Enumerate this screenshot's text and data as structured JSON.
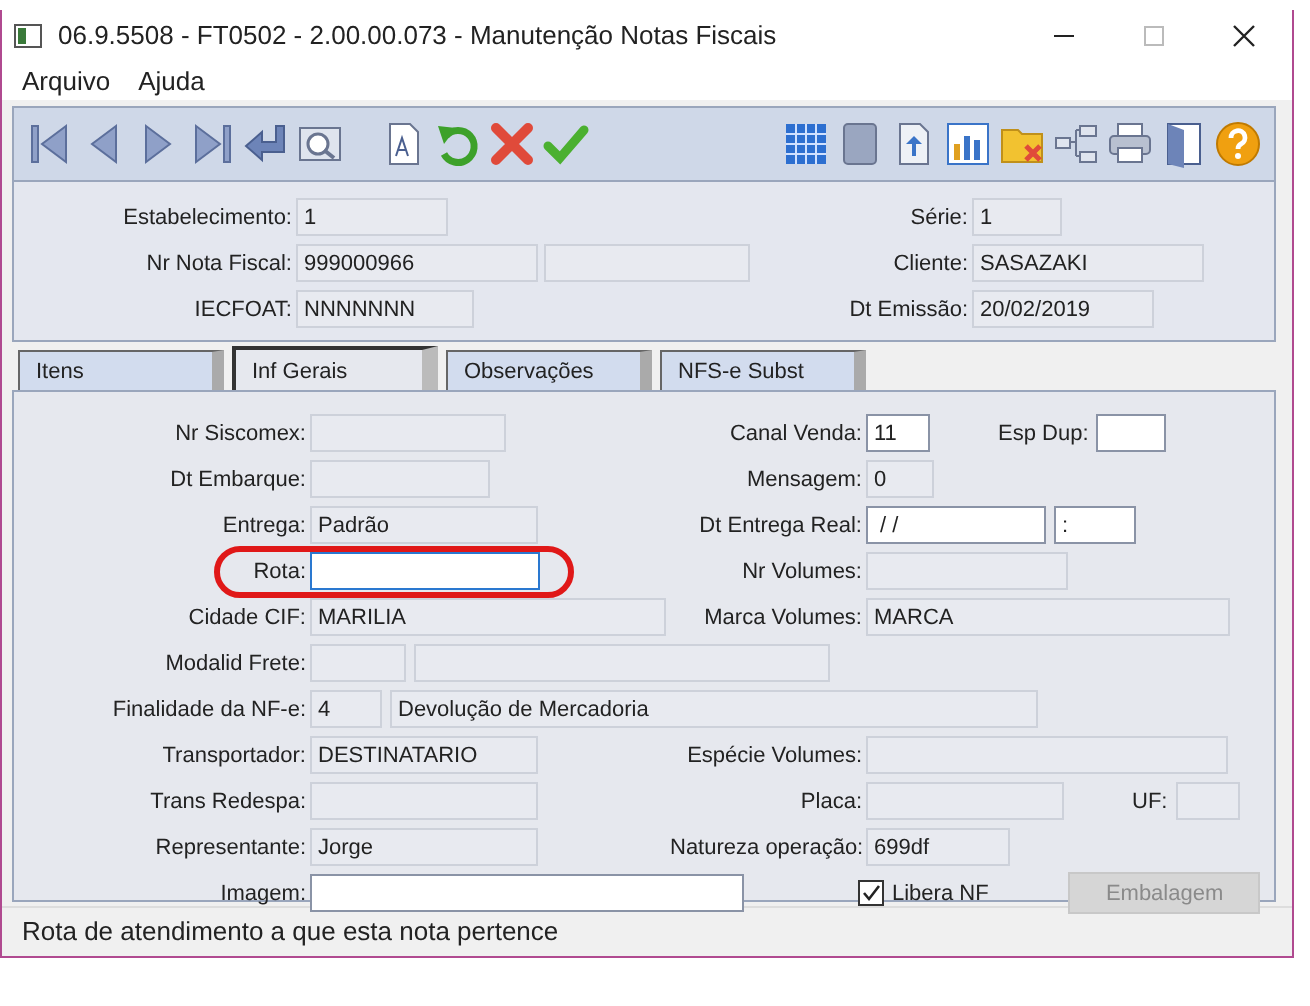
{
  "window": {
    "title": "06.9.5508 - FT0502 - 2.00.00.073 - Manutenção Notas Fiscais"
  },
  "menu": [
    "Arquivo",
    "Ajuda"
  ],
  "header": {
    "estabelecimento": {
      "label": "Estabelecimento:",
      "value": "1",
      "disabled": true
    },
    "serie": {
      "label": "Série:",
      "value": "1",
      "disabled": true
    },
    "nr_nota_fiscal": {
      "label": "Nr Nota Fiscal:",
      "value": "999000966",
      "disabled": true
    },
    "nr_nota_fiscal_2": {
      "disabled": true
    },
    "cliente": {
      "label": "Cliente:",
      "value": "SASAZAKI",
      "disabled": true
    },
    "iecfoat": {
      "label": "IECFOAT:",
      "value": "NNNNNNN",
      "disabled": true
    },
    "dt_emissao": {
      "label": "Dt Emissão:",
      "value": "20/02/2019",
      "disabled": true
    }
  },
  "tabs": [
    {
      "label": "Itens",
      "selected": false
    },
    {
      "label": "Inf  Gerais",
      "selected": true
    },
    {
      "label": "Observações",
      "selected": false
    },
    {
      "label": "NFS-e Subst",
      "selected": false
    }
  ],
  "form": {
    "nr_siscomex": {
      "label": "Nr Siscomex:",
      "disabled": true
    },
    "canal_venda": {
      "label": "Canal Venda:",
      "value": "11",
      "disabled": false
    },
    "esp_dup": {
      "label": "Esp Dup:",
      "disabled": false
    },
    "dt_embarque": {
      "label": "Dt Embarque:",
      "disabled": true
    },
    "mensagem": {
      "label": "Mensagem:",
      "value": "0",
      "disabled": true
    },
    "entrega": {
      "label": "Entrega:",
      "value": "Padrão",
      "disabled": true
    },
    "dt_entrega_real": {
      "label": "Dt Entrega Real:",
      "value": " / /",
      "disabled": false
    },
    "hora_entrega": {
      "value": ":",
      "disabled": false
    },
    "rota": {
      "label": "Rota:",
      "disabled": false,
      "focused": true,
      "highlighted": true
    },
    "nr_volumes": {
      "label": "Nr Volumes:",
      "disabled": true
    },
    "cidade_cif": {
      "label": "Cidade CIF:",
      "value": "MARILIA",
      "disabled": true
    },
    "marca_volumes": {
      "label": "Marca Volumes:",
      "value": "MARCA",
      "disabled": true
    },
    "modalid_frete": {
      "label": "Modalid Frete:",
      "disabled": true
    },
    "modalid_frete_desc": {
      "disabled": true
    },
    "finalidade": {
      "label": "Finalidade da NF-e:",
      "value": "4",
      "disabled": true
    },
    "finalidade_desc": {
      "value": "Devolução de Mercadoria",
      "disabled": true
    },
    "transportador": {
      "label": "Transportador:",
      "value": "DESTINATARIO",
      "disabled": true
    },
    "especie_volumes": {
      "label": "Espécie Volumes:",
      "disabled": true
    },
    "trans_redespa": {
      "label": "Trans Redespa:",
      "disabled": true
    },
    "placa": {
      "label": "Placa:",
      "disabled": true
    },
    "uf": {
      "label": "UF:",
      "disabled": true
    },
    "representante": {
      "label": "Representante:",
      "value": "Jorge",
      "disabled": true
    },
    "natureza_operacao": {
      "label": "Natureza operação:",
      "value": "699df",
      "disabled": true
    },
    "imagem": {
      "label": "Imagem:",
      "disabled": false
    },
    "libera_nf": {
      "label": "Libera NF",
      "checked": true
    },
    "embalagem": {
      "label": "Embalagem",
      "disabled": true
    }
  },
  "status_bar": "Rota de atendimento a que esta nota pertence"
}
